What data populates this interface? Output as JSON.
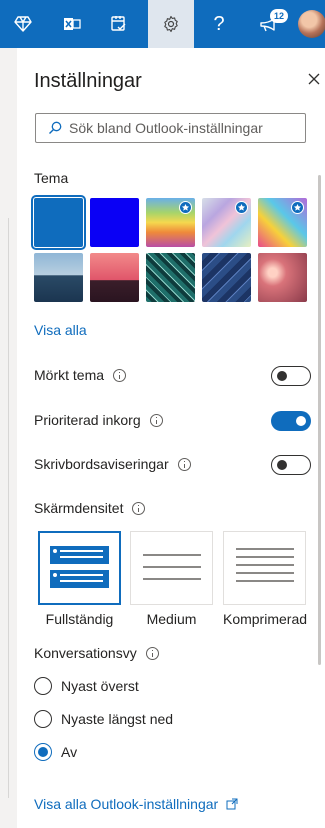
{
  "colors": {
    "accent": "#0f6cbd",
    "topbar": "#0f6cbd"
  },
  "topbar": {
    "icons": [
      "diamond-icon",
      "excel-icon",
      "mail-check-icon",
      "gear-icon",
      "help-icon",
      "megaphone-icon",
      "avatar"
    ],
    "help_label": "?",
    "notification_count": "12"
  },
  "settings": {
    "title": "Inställningar",
    "search": {
      "placeholder": "Sök bland Outlook-inställningar"
    },
    "theme": {
      "heading": "Tema",
      "selected": "Blå",
      "view_all": "Visa alla"
    },
    "toggles": [
      {
        "label": "Mörkt tema",
        "on": false
      },
      {
        "label": "Prioriterad inkorg",
        "on": true
      },
      {
        "label": "Skrivbordsaviseringar",
        "on": false
      }
    ],
    "density": {
      "heading": "Skärmdensitet",
      "options": [
        {
          "label": "Fullständig",
          "selected": true
        },
        {
          "label": "Medium",
          "selected": false
        },
        {
          "label": "Komprimerad",
          "selected": false
        }
      ]
    },
    "conversation": {
      "heading": "Konversationsvy",
      "options": [
        {
          "label": "Nyast överst",
          "selected": false
        },
        {
          "label": "Nyaste längst ned",
          "selected": false
        },
        {
          "label": "Av",
          "selected": true
        }
      ]
    },
    "footer_link": "Visa alla Outlook-inställningar"
  }
}
